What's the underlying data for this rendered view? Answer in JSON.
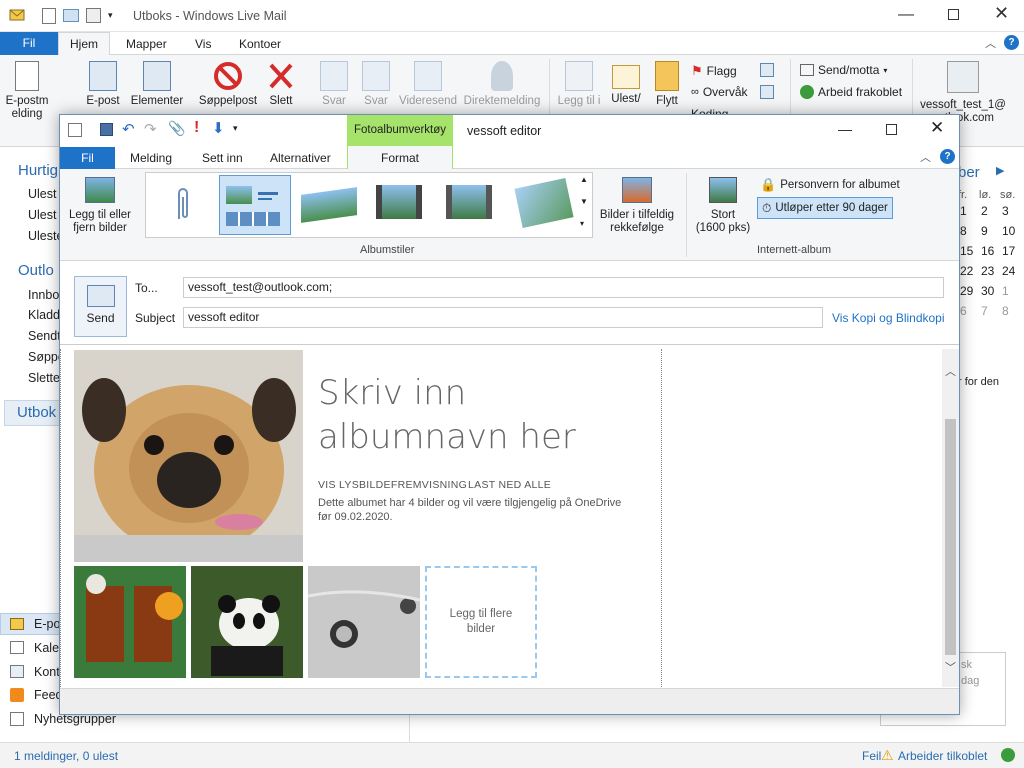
{
  "main_window": {
    "title": "Utboks - Windows Live Mail",
    "tabs": {
      "file": "Fil",
      "home": "Hjem",
      "folders": "Mapper",
      "view": "Vis",
      "accounts": "Kontoer"
    },
    "ribbon": {
      "email": "E-postmelding",
      "email_partial": "E-post",
      "elements": "Elementer",
      "junk": "Søppelpost",
      "delete": "Slett",
      "reply": "Svar",
      "reply_all": "Svar",
      "forward": "Videresend",
      "im": "Direktemelding",
      "add_to": "Legg til i",
      "read_unread": "Ulest/",
      "move": "Flytt",
      "flag": "Flagg",
      "watch": "Overvåk",
      "encoding": "Koding",
      "send_receive": "Send/motta",
      "work_offline": "Arbeid frakoblet",
      "account": "vessoft_test_1@",
      "account_domain": "outlook.com"
    },
    "nav": {
      "quick": "Hurtig",
      "quick_items": [
        "Ulest",
        "Ulest",
        "Uleste"
      ],
      "outlook": "Outlo",
      "outlook_items": [
        "Innbo",
        "Kladd",
        "Sendt",
        "Søppe",
        "Slette"
      ],
      "outbox": "Utbok",
      "bottom": [
        "E-po",
        "Kale",
        "Kont",
        "Feed",
        "Nyhetsgrupper"
      ]
    },
    "calendar": {
      "month_partial": "ber",
      "day_headers": [
        "fr.",
        "lø.",
        "sø."
      ],
      "rows": [
        [
          "1",
          "2",
          "3"
        ],
        [
          "8",
          "9",
          "10"
        ],
        [
          "15",
          "16",
          "17"
        ],
        [
          "22",
          "23",
          "24"
        ],
        [
          "29",
          "30",
          "1"
        ],
        [
          "6",
          "7",
          "8"
        ]
      ],
      "note": "r for den",
      "search_partial": [
        "sk",
        "dag"
      ]
    },
    "status": {
      "left": "1 meldinger, 0 ulest",
      "error": "Feil",
      "online": "Arbeider tilkoblet"
    }
  },
  "compose": {
    "context_tab": "Fotoalbumverktøy",
    "title": "vessoft editor",
    "tabs": {
      "file": "Fil",
      "message": "Melding",
      "insert": "Sett inn",
      "options": "Alternativer",
      "format": "Format"
    },
    "ribbon": {
      "add_remove": "Legg til eller fjern bilder",
      "group_styles": "Albumstiler",
      "shuffle": "Bilder i tilfeldig rekkefølge",
      "size": "Stort",
      "size_detail": "(1600 pks)",
      "privacy": "Personvern for albumet",
      "expires": "Utløper etter 90 dager",
      "group_web": "Internett-album"
    },
    "send": "Send",
    "to_label": "To...",
    "to_value": "vessoft_test@outlook.com;",
    "subject_label": "Subject",
    "subject_value": "vessoft editor",
    "cc_link": "Vis Kopi og Blindkopi",
    "album": {
      "title": "Skriv inn albumnavn her",
      "slideshow": "VIS LYSBILDEFREMVISNING",
      "download": "LAST NED ALLE",
      "desc": "Dette albumet har 4 bilder og vil være tilgjengelig på OneDrive før 09.02.2020.",
      "add_more": "Legg til flere bilder"
    }
  },
  "colors": {
    "accent": "#1e73c8",
    "ribbon_bg": "#f5f6f7",
    "context_tab": "#a5e36a"
  }
}
